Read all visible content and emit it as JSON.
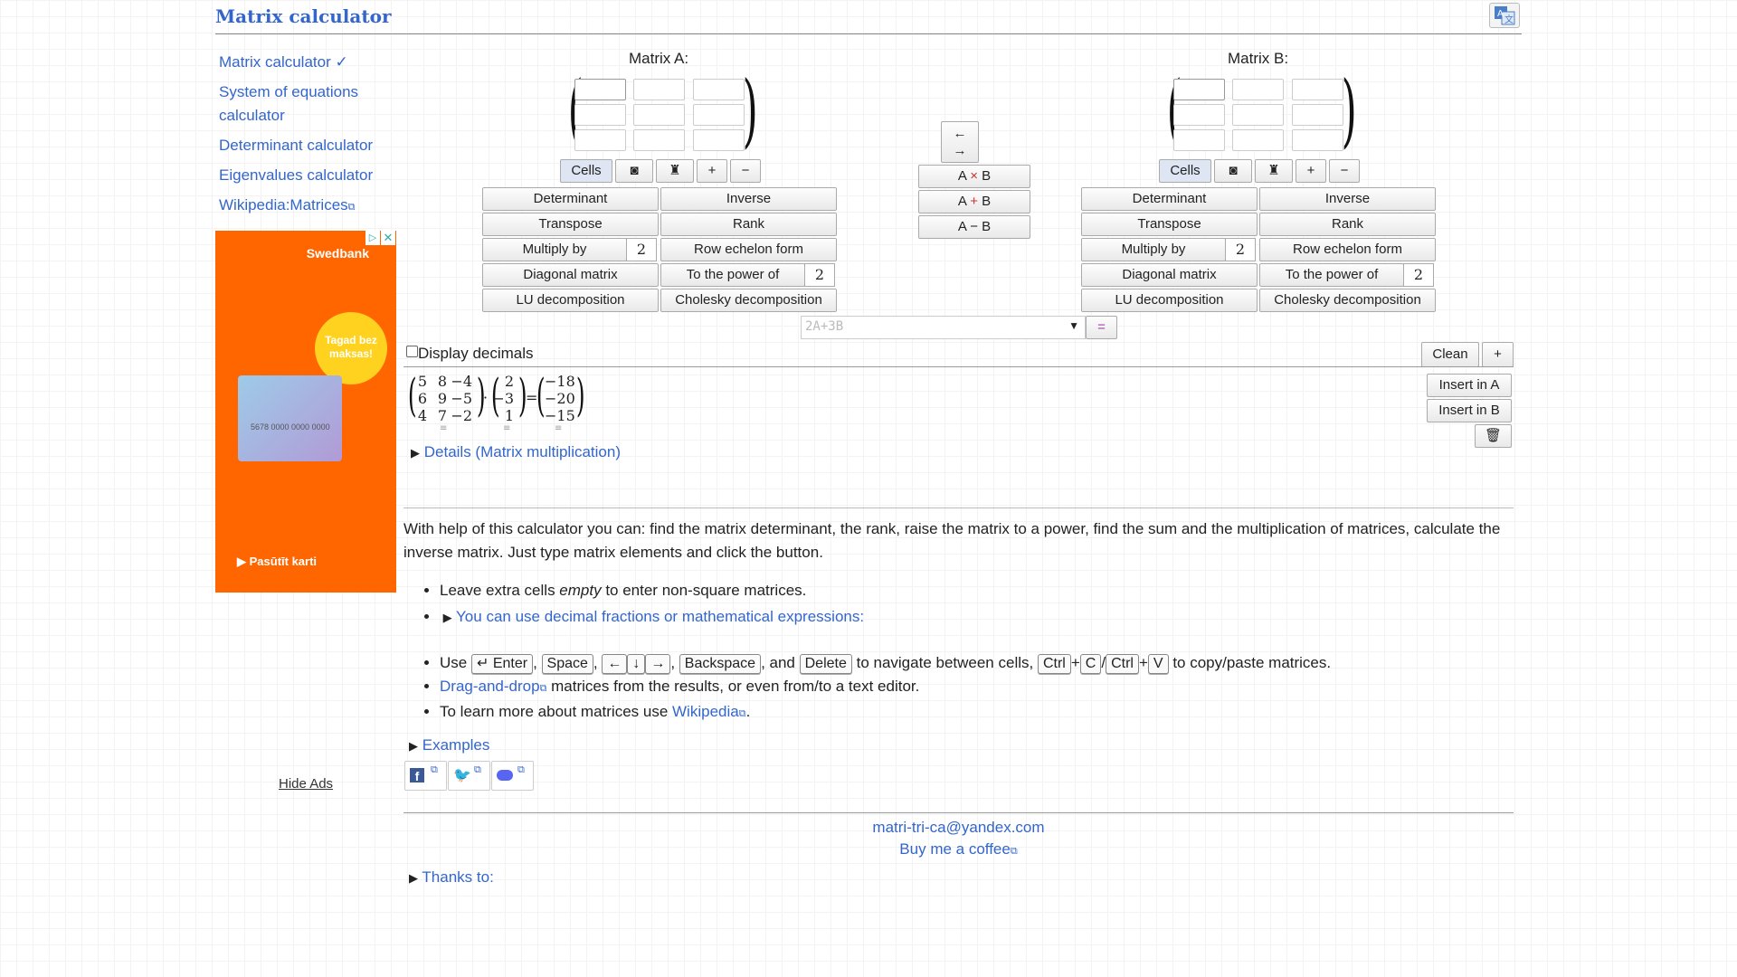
{
  "header": {
    "title": "Matrix calculator",
    "translate_icon": "translate-icon"
  },
  "sidebar": {
    "items": [
      {
        "label": "Matrix calculator ✓"
      },
      {
        "label": "System of equations calculator",
        "line1": "System of equations",
        "line2": "calculator"
      },
      {
        "label": "Determinant calculator"
      },
      {
        "label": "Eigenvalues calculator"
      },
      {
        "label": "Wikipedia:Matrices"
      }
    ],
    "ad": {
      "brand": "Swedbank",
      "badge": "Tagad bez maksas!",
      "badge1": "Tagad bez",
      "badge2": "maksas!",
      "card_number": "5678 0000 0000 0000",
      "card_brand": "Swedbank",
      "cta": "Pasūtīt karti",
      "bg": "#ff6600"
    },
    "hide_ads": "Hide Ads"
  },
  "matrixA": {
    "title": "Matrix A:",
    "cells_label": "Cells",
    "plus": "+",
    "minus": "−",
    "ops": {
      "determinant": "Determinant",
      "inverse": "Inverse",
      "transpose": "Transpose",
      "rank": "Rank",
      "multiply_by": "Multiply by",
      "multiply_value": "2",
      "row_echelon": "Row echelon form",
      "diagonal": "Diagonal matrix",
      "power": "To the power of",
      "power_value": "2",
      "lu": "LU decomposition",
      "cholesky": "Cholesky decomposition"
    }
  },
  "matrixB": {
    "title": "Matrix B:",
    "cells_label": "Cells",
    "plus": "+",
    "minus": "−",
    "ops": {
      "determinant": "Determinant",
      "inverse": "Inverse",
      "transpose": "Transpose",
      "rank": "Rank",
      "multiply_by": "Multiply by",
      "multiply_value": "2",
      "row_echelon": "Row echelon form",
      "diagonal": "Diagonal matrix",
      "power": "To the power of",
      "power_value": "2",
      "lu": "LU decomposition",
      "cholesky": "Cholesky decomposition"
    }
  },
  "middle": {
    "swap_left": "←",
    "swap_right": "→",
    "axb_a": "A",
    "axb_op": "×",
    "axb_b": "B",
    "apb_a": "A",
    "apb_op": "+",
    "apb_b": "B",
    "amb": "A − B",
    "expr_placeholder": "2A+3B",
    "equals": "="
  },
  "results": {
    "display_decimals": "Display decimals",
    "clean": "Clean",
    "plus": "+",
    "insert_a": "Insert in A",
    "insert_b": "Insert in B",
    "matrix1": [
      [
        "5",
        "8",
        "−4"
      ],
      [
        "6",
        "9",
        "−5"
      ],
      [
        "4",
        "7",
        "−2"
      ]
    ],
    "vector1": [
      "2",
      "−3",
      "1"
    ],
    "vector2": [
      "−18",
      "−20",
      "−15"
    ],
    "dot": "·",
    "eq": "=",
    "details": "Details (Matrix multiplication)"
  },
  "info": {
    "intro": "With help of this calculator you can: find the matrix determinant, the rank, raise the matrix to a power, find the sum and the multiplication of matrices, calculate the inverse matrix. Just type matrix elements and click the button.",
    "b1_pre": "Leave extra cells ",
    "b1_em": "empty",
    "b1_post": " to enter non-square matrices.",
    "b2": "You can use decimal fractions or mathematical expressions:",
    "b3_use": "Use",
    "k_enter": "↵ Enter",
    "k_space": "Space",
    "k_left": "←",
    "k_down": "↓",
    "k_up": "↑",
    "k_right": "→",
    "k_backspace": "Backspace",
    "b3_and": ", and",
    "k_delete": "Delete",
    "b3_nav": " to navigate between cells, ",
    "k_ctrl": "Ctrl",
    "k_c": "C",
    "k_v": "V",
    "b3_copy": " to copy/paste matrices.",
    "b4_link": "Drag-and-drop",
    "b4_text": " matrices from the results, or even from/to a text editor.",
    "b5_text": "To learn more about matrices use ",
    "b5_link": "Wikipedia",
    "b5_end": ".",
    "examples": "Examples"
  },
  "footer": {
    "email": "matri-tri-ca@yandex.com",
    "coffee": "Buy me a coffee",
    "thanks": "Thanks to:"
  }
}
